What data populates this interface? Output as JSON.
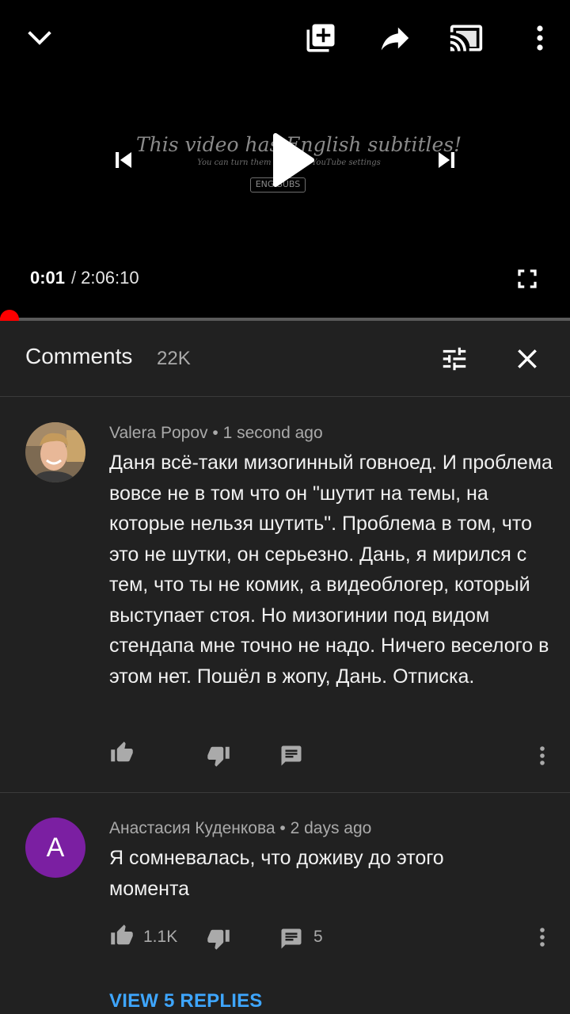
{
  "player": {
    "subtitle_overlay": {
      "title": "This video has English subtitles!",
      "note": "You can turn them on in the YouTube settings",
      "badge": "ENG SUBS"
    },
    "current_time": "0:01",
    "separator": "/",
    "duration": "2:06:10",
    "progress_fraction": 0.0,
    "icons": [
      "chevron-down-icon",
      "add-to-playlist-icon",
      "share-icon",
      "cast-icon",
      "more-vert-icon",
      "skip-previous-icon",
      "play-icon",
      "skip-next-icon",
      "fullscreen-icon"
    ]
  },
  "comments_header": {
    "title": "Comments",
    "count": "22K",
    "icons": [
      "sort-icon",
      "close-icon"
    ]
  },
  "comments": [
    {
      "author": "Valera Popov",
      "time": "1 second ago",
      "text": "Даня всё-таки мизогинный говноед. И проблема вовсе не в том что он \"шутит на темы, на которые нельзя шутить\". Проблема в том, что это не шутки, он серьезно. Дань, я мирился с тем, что ты не комик, а видеоблогер, который выступает стоя. Но мизогинии под видом стендапа мне точно не надо. Ничего веселого в этом нет. Пошёл в жопу, Дань. Отписка.",
      "likes": "",
      "replies_count": "",
      "avatar_color": "#8a6f4e"
    },
    {
      "author": "Анастасия Куденкова",
      "time": "2 days ago",
      "text": "Я сомневалась, что доживу до этого момента",
      "likes": "1.1K",
      "replies_count": "5",
      "avatar_letter": "A",
      "avatar_color": "#7b1fa2"
    }
  ],
  "view_replies": "VIEW 5 REPLIES",
  "colors": {
    "background": "#212121",
    "player": "#000000",
    "accent_red": "#ff0000",
    "link_blue": "#3ea6ff",
    "secondary_text": "#aaaaaa"
  }
}
